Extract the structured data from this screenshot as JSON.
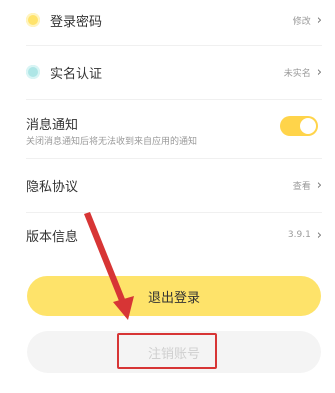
{
  "settings": {
    "login_password": {
      "label": "登录密码",
      "value": "修改"
    },
    "verification": {
      "label": "实名认证",
      "value": "未实名"
    },
    "notifications": {
      "title": "消息通知",
      "subtitle": "关闭消息通知后将无法收到来自应用的通知",
      "enabled": true
    },
    "privacy": {
      "label": "隐私协议",
      "value": "查看"
    },
    "version": {
      "label": "版本信息",
      "value": "3.9.1"
    }
  },
  "actions": {
    "logout_label": "退出登录",
    "cancel_account_label": "注销账号"
  },
  "colors": {
    "accent_yellow": "#fee36a",
    "toggle_on": "#ffd44a",
    "annotation_red": "#d73535"
  }
}
